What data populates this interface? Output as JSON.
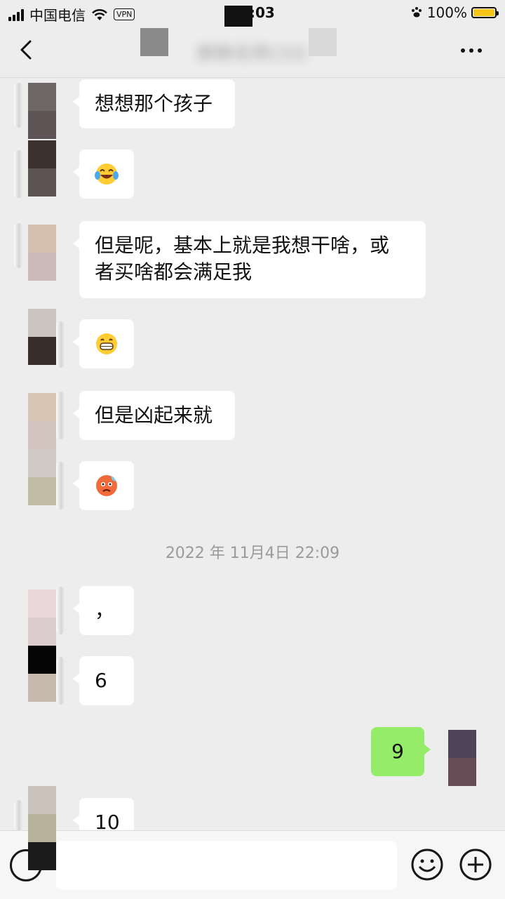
{
  "status_bar": {
    "carrier": "中国电信",
    "vpn_label": "VPN",
    "time": "08:03",
    "battery_percent": "100%"
  },
  "header": {
    "title": "群聊名称(33)"
  },
  "messages": [
    {
      "side": "left",
      "text": "想想那个孩子"
    },
    {
      "side": "left",
      "emoji": "laughing-tears-emoji"
    },
    {
      "side": "left",
      "text_line1": "但是呢，基本上就是我想干啥，或",
      "text_line2": "者买啥都会满足我"
    },
    {
      "side": "left",
      "emoji": "grinning-emoji"
    },
    {
      "side": "left",
      "text": "但是凶起来就"
    },
    {
      "side": "left",
      "emoji": "angry-sweat-emoji"
    },
    {
      "side": "left",
      "text": "，"
    },
    {
      "side": "left",
      "text": "6"
    },
    {
      "side": "right",
      "text": "9"
    },
    {
      "side": "left",
      "text": "10"
    }
  ],
  "timestamp": "2022 年 11月4日 22:09",
  "colors": {
    "background": "#ededed",
    "self_bubble": "#95ec69",
    "other_bubble": "#ffffff",
    "battery": "#f5c518"
  },
  "icons": {
    "back": "chevron-left-icon",
    "more": "more-dots-icon",
    "voice": "voice-icon",
    "emoji": "emoji-icon",
    "plus": "plus-icon"
  }
}
